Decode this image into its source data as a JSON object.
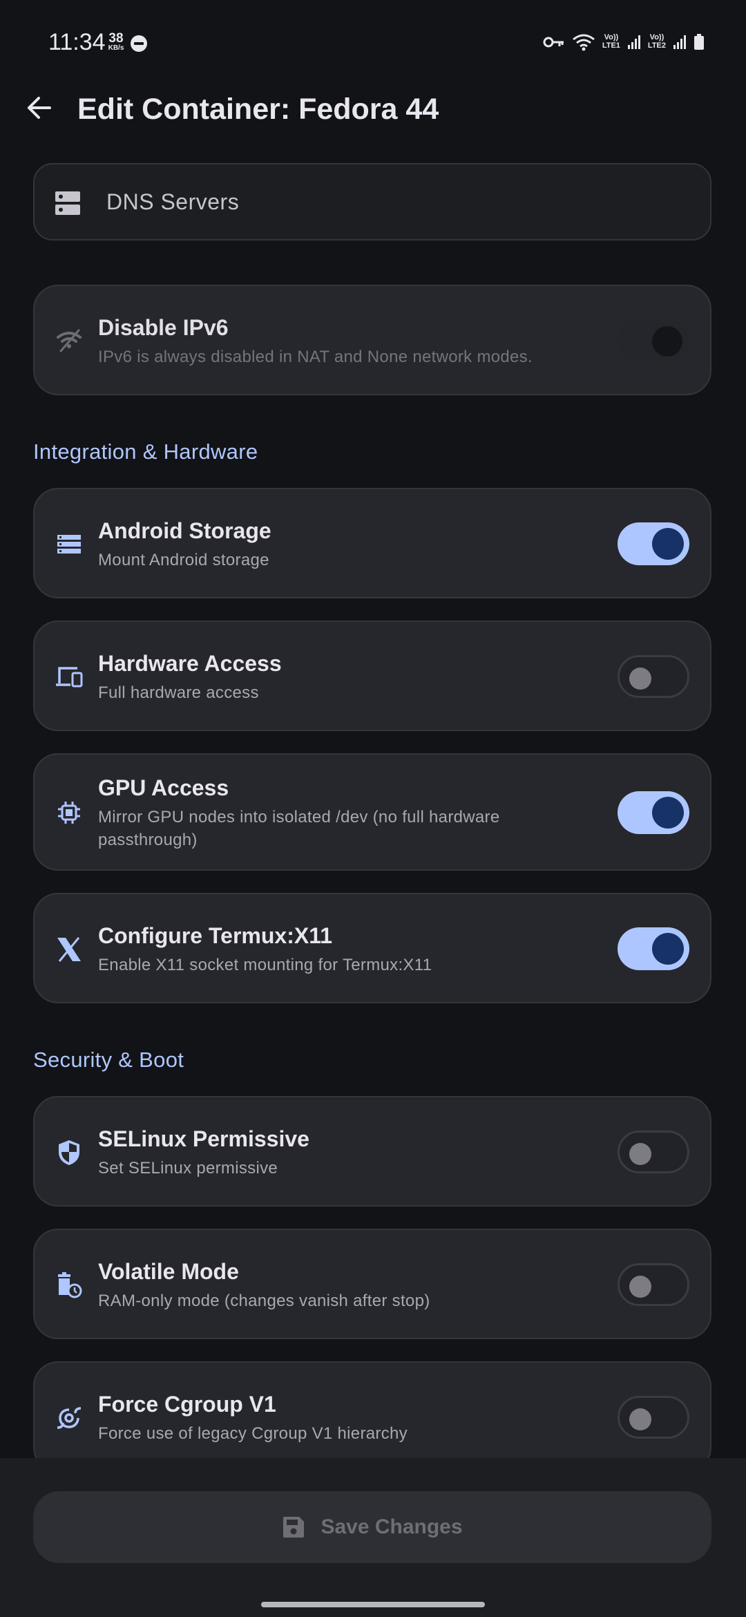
{
  "status_bar": {
    "time": "11:34",
    "net_speed": "38",
    "net_speed_unit": "KB/s",
    "sim1_label": [
      "Vo))",
      "LTE1"
    ],
    "sim2_label": [
      "Vo))",
      "LTE2"
    ]
  },
  "app_bar": {
    "title": "Edit Container: Fedora 44",
    "back_icon": "arrow-back-icon"
  },
  "dns": {
    "label": "DNS Servers",
    "icon": "dns-icon"
  },
  "network": {
    "ipv6": {
      "title": "Disable IPv6",
      "subtitle": "IPv6 is always disabled in NAT and None network modes.",
      "enabled": false,
      "disabled_control": true,
      "icon": "wifi-off-icon"
    }
  },
  "sections": {
    "integration": "Integration & Hardware",
    "security": "Security & Boot"
  },
  "integration_items": [
    {
      "title": "Android Storage",
      "subtitle": "Mount Android storage",
      "on": true,
      "icon": "storage-icon"
    },
    {
      "title": "Hardware Access",
      "subtitle": "Full hardware access",
      "on": false,
      "icon": "devices-icon"
    },
    {
      "title": "GPU Access",
      "subtitle": "Mirror GPU nodes into isolated /dev (no full hardware passthrough)",
      "on": true,
      "icon": "chip-icon"
    },
    {
      "title": "Configure Termux:X11",
      "subtitle": "Enable X11 socket mounting for Termux:X11",
      "on": true,
      "icon": "x-icon"
    }
  ],
  "security_items": [
    {
      "title": "SELinux Permissive",
      "subtitle": "Set SELinux permissive",
      "on": false,
      "icon": "shield-icon"
    },
    {
      "title": "Volatile Mode",
      "subtitle": "RAM-only mode (changes vanish after stop)",
      "on": false,
      "icon": "delete-clock-icon"
    },
    {
      "title": "Force Cgroup V1",
      "subtitle": "Force use of legacy Cgroup V1 hierarchy",
      "on": false,
      "icon": "cyclone-icon"
    }
  ],
  "save_button": {
    "label": "Save Changes",
    "icon": "save-icon"
  },
  "colors": {
    "background": "#121317",
    "card": "#26272c",
    "accent": "#aec6ff",
    "toggle_knob_on": "#173266",
    "section_header": "#afc6ff"
  }
}
